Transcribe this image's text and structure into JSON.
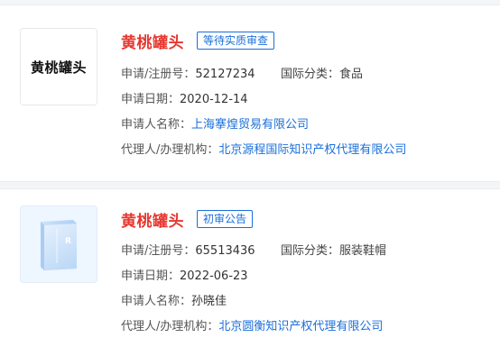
{
  "labels": {
    "reg_no": "申请/注册号：",
    "intl_class": "国际分类：",
    "app_date": "申请日期：",
    "applicant": "申请人名称：",
    "agent": "代理人/办理机构："
  },
  "results": [
    {
      "thumbnail_text": "黄桃罐头",
      "name": "黄桃罐头",
      "status": "等待实质审查",
      "reg_no": "52127234",
      "intl_class": "食品",
      "app_date": "2020-12-14",
      "applicant": "上海搴煌贸易有限公司",
      "agent": "北京源程国际知识产权代理有限公司"
    },
    {
      "thumbnail_icon": "book-icon",
      "name": "黄桃罐头",
      "status": "初审公告",
      "reg_no": "65513436",
      "intl_class": "服装鞋帽",
      "app_date": "2022-06-23",
      "applicant": "孙晓佳",
      "agent": "北京圆衡知识产权代理有限公司"
    }
  ],
  "colors": {
    "trademark_name": "#e6372f",
    "link": "#1b6fd8",
    "badge": "#1b6fd8"
  }
}
